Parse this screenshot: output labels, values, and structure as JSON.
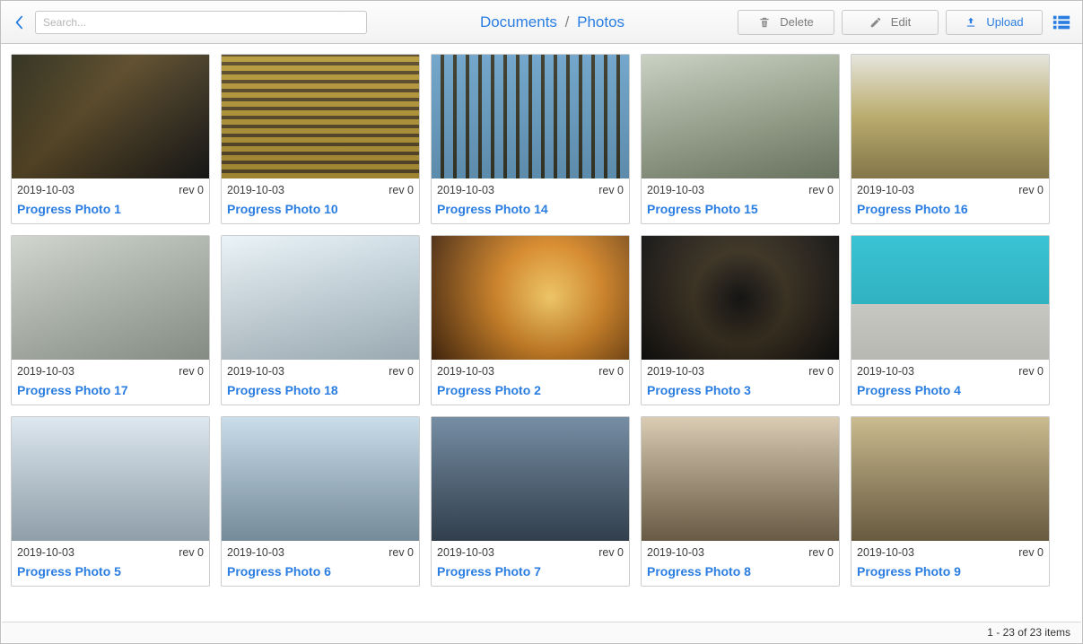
{
  "toolbar": {
    "search_placeholder": "Search...",
    "delete_label": "Delete",
    "edit_label": "Edit",
    "upload_label": "Upload"
  },
  "breadcrumb": {
    "root": "Documents",
    "sep": "/",
    "current": "Photos"
  },
  "status": {
    "text": "1 - 23 of 23 items"
  },
  "items": [
    {
      "date": "2019-10-03",
      "rev": "rev 0",
      "title": "Progress Photo 1"
    },
    {
      "date": "2019-10-03",
      "rev": "rev 0",
      "title": "Progress Photo 10"
    },
    {
      "date": "2019-10-03",
      "rev": "rev 0",
      "title": "Progress Photo 14"
    },
    {
      "date": "2019-10-03",
      "rev": "rev 0",
      "title": "Progress Photo 15"
    },
    {
      "date": "2019-10-03",
      "rev": "rev 0",
      "title": "Progress Photo 16"
    },
    {
      "date": "2019-10-03",
      "rev": "rev 0",
      "title": "Progress Photo 17"
    },
    {
      "date": "2019-10-03",
      "rev": "rev 0",
      "title": "Progress Photo 18"
    },
    {
      "date": "2019-10-03",
      "rev": "rev 0",
      "title": "Progress Photo 2"
    },
    {
      "date": "2019-10-03",
      "rev": "rev 0",
      "title": "Progress Photo 3"
    },
    {
      "date": "2019-10-03",
      "rev": "rev 0",
      "title": "Progress Photo 4"
    },
    {
      "date": "2019-10-03",
      "rev": "rev 0",
      "title": "Progress Photo 5"
    },
    {
      "date": "2019-10-03",
      "rev": "rev 0",
      "title": "Progress Photo 6"
    },
    {
      "date": "2019-10-03",
      "rev": "rev 0",
      "title": "Progress Photo 7"
    },
    {
      "date": "2019-10-03",
      "rev": "rev 0",
      "title": "Progress Photo 8"
    },
    {
      "date": "2019-10-03",
      "rev": "rev 0",
      "title": "Progress Photo 9"
    }
  ]
}
